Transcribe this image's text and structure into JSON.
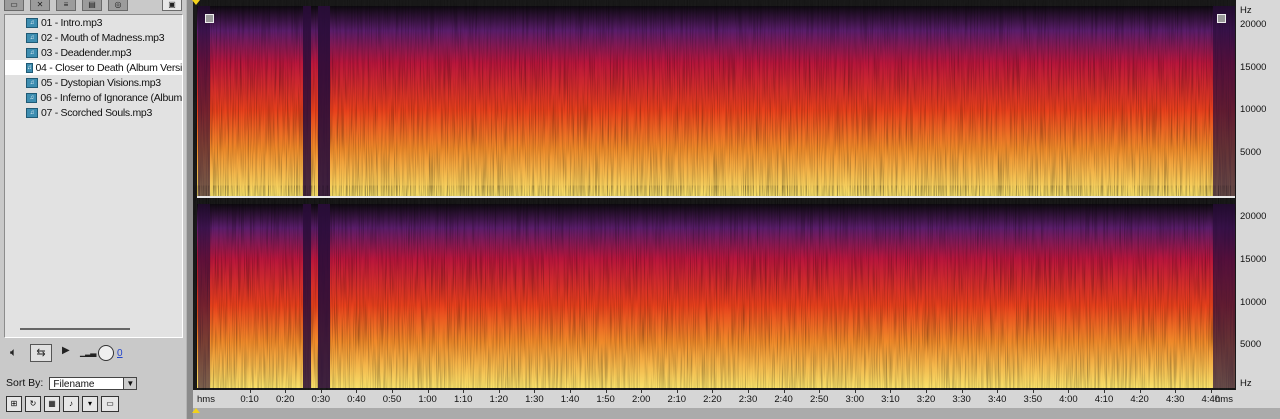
{
  "toolbar": {
    "icons": [
      "open-file-icon",
      "close-file-icon",
      "batch-icon",
      "cd-icon",
      "info-icon",
      "options-icon"
    ]
  },
  "files": [
    {
      "label": "01 - Intro.mp3",
      "selected": false
    },
    {
      "label": "02 - Mouth of Madness.mp3",
      "selected": false
    },
    {
      "label": "03 - Deadender.mp3",
      "selected": false
    },
    {
      "label": "04 - Closer to Death (Album Versi",
      "selected": true
    },
    {
      "label": "05 - Dystopian Visions.mp3",
      "selected": false
    },
    {
      "label": "06 - Inferno of Ignorance (Album",
      "selected": false
    },
    {
      "label": "07 - Scorched Souls.mp3",
      "selected": false
    }
  ],
  "transport": {
    "volume_value": "0"
  },
  "sort": {
    "label": "Sort By:",
    "value": "Filename"
  },
  "timeline": {
    "start_label": "hms",
    "end_label": "hms",
    "ticks": [
      "0:10",
      "0:20",
      "0:30",
      "0:40",
      "0:50",
      "1:00",
      "1:10",
      "1:20",
      "1:30",
      "1:40",
      "1:50",
      "2:00",
      "2:10",
      "2:20",
      "2:30",
      "2:40",
      "2:50",
      "3:00",
      "3:10",
      "3:20",
      "3:30",
      "3:40",
      "3:50",
      "4:00",
      "4:10",
      "4:20",
      "4:30",
      "4:40"
    ]
  },
  "ruler": {
    "unit": "Hz",
    "top_labels": [
      "20000",
      "15000",
      "10000",
      "5000"
    ],
    "bottom_labels": [
      "20000",
      "15000",
      "10000",
      "5000"
    ],
    "bottom_unit": "Hz"
  },
  "colors": {
    "spec_low": "#f7e06a",
    "spec_mid": "#e8401c",
    "spec_high": "#5a1d6a",
    "spec_bg": "#0e0a10"
  }
}
